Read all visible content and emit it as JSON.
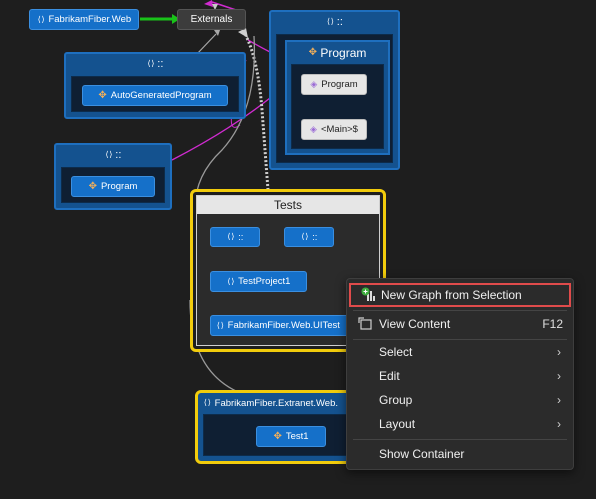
{
  "graph": {
    "top_node": "FabrikamFiber.Web",
    "externals": "Externals",
    "namespace_label": "{} ::",
    "auto_generated": "AutoGeneratedProgram",
    "program_left": "Program",
    "program_group": "Program",
    "program_class": "Program",
    "main_method": "<Main>$",
    "tests_group": "Tests",
    "test_project": "TestProject1",
    "uitest": "FabrikamFiber.Web.UITest",
    "extranet_web": "FabrikamFiber.Extranet.Web.",
    "test1": "Test1"
  },
  "context_menu": {
    "items": [
      {
        "label": "New Graph from Selection",
        "shortcut": "",
        "icon": "new-graph-icon",
        "submenu": false,
        "highlighted": true
      },
      {
        "label": "View Content",
        "shortcut": "F12",
        "icon": "view-content-icon",
        "submenu": false
      },
      {
        "label": "Select",
        "shortcut": "",
        "submenu": true
      },
      {
        "label": "Edit",
        "shortcut": "",
        "submenu": true
      },
      {
        "label": "Group",
        "shortcut": "",
        "submenu": true
      },
      {
        "label": "Layout",
        "shortcut": "",
        "submenu": true
      },
      {
        "label": "Show Container",
        "shortcut": "",
        "submenu": false
      }
    ],
    "highlight_color": "#e04b4b"
  },
  "colors": {
    "background": "#1e1e1e",
    "selection_border": "#f2cc0c",
    "node_blue": "#1570c9",
    "edge_green": "#19c219",
    "edge_magenta": "#d02bd0"
  }
}
